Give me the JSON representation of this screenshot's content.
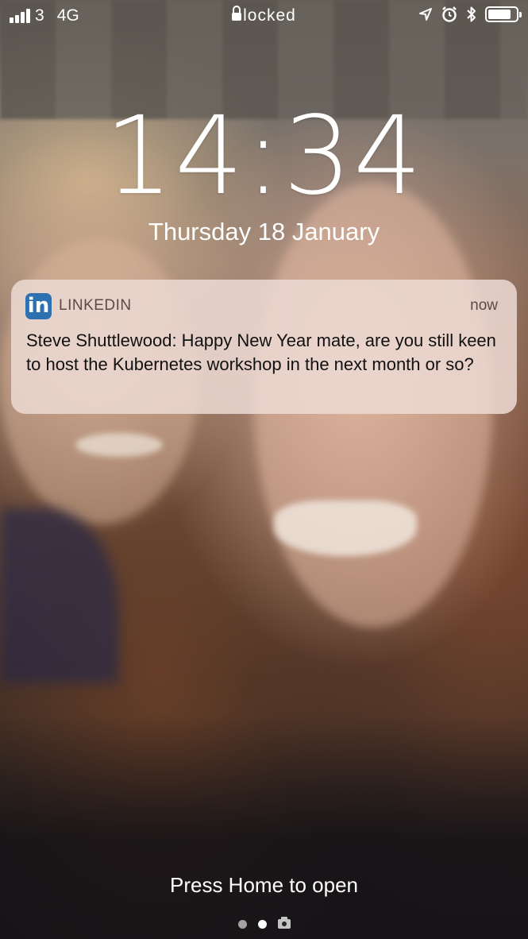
{
  "status_bar": {
    "signal_bars": 4,
    "carrier": "3",
    "network": "4G",
    "lock_state": "locked",
    "location_icon": "location-arrow-icon",
    "alarm_icon": "alarm-clock-icon",
    "bluetooth_icon": "bluetooth-icon",
    "battery_level": 0.85
  },
  "lock_screen": {
    "time": "14:34",
    "date": "Thursday 18 January",
    "unlock_hint": "Press Home to open"
  },
  "notification": {
    "app_icon": "linkedin-icon",
    "app_icon_text": "in",
    "app_name": "LINKEDIN",
    "time": "now",
    "message": "Steve Shuttlewood: Happy New Year mate, are you still keen to host the Kubernetes workshop in the next month or so?",
    "accent_color": "#2e71b1"
  },
  "page_indicator": {
    "pages": 2,
    "active_page": 2,
    "camera_icon": "camera-icon"
  }
}
